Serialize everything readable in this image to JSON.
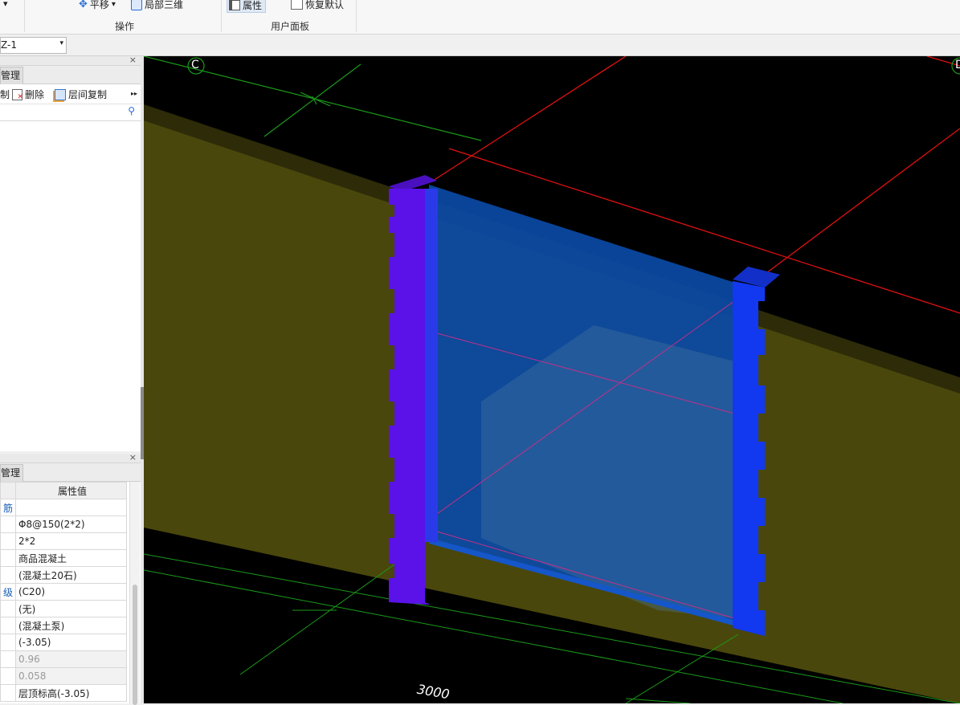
{
  "ribbon": {
    "pan_label": "平移",
    "pan_dropdown": "▾",
    "local3d_label": "局部三维",
    "props_label": "属性",
    "restore_label": "恢复默认",
    "group_operations": "操作",
    "group_user_panel": "用户面板",
    "left_arrow": "▾"
  },
  "toolbar2": {
    "component_value": "Z-1"
  },
  "top_panel": {
    "tab_label": "管理",
    "copy_partial": "制",
    "delete_label": "删除",
    "floor_copy_label": "层间复制",
    "more": "▸▸"
  },
  "bottom_panel": {
    "tab_label": "管理",
    "header_value": "属性值",
    "rows": [
      {
        "name": "筋",
        "value": ""
      },
      {
        "name": "",
        "value": "Φ8@150(2*2)"
      },
      {
        "name": "",
        "value": "2*2"
      },
      {
        "name": "",
        "value": "商品混凝土"
      },
      {
        "name": "",
        "value": "(混凝土20石)"
      },
      {
        "name": "级",
        "value": "(C20)"
      },
      {
        "name": "",
        "value": "(无)"
      },
      {
        "name": "",
        "value": "(混凝土泵)"
      },
      {
        "name": "",
        "value": "(-3.05)"
      },
      {
        "name": "",
        "value": "0.96",
        "grey": true
      },
      {
        "name": "",
        "value": "0.058",
        "grey": true
      },
      {
        "name": "",
        "value": "层顶标高(-3.05)"
      }
    ]
  },
  "viewport": {
    "axis_c": "C",
    "axis_d": "D",
    "dimension": "3000",
    "colors": {
      "wall": "#4a470c",
      "column_left": "#5a12e8",
      "column_right": "#1238f0",
      "opening": "#0a4aa6",
      "grid_red": "#e01010",
      "grid_green": "#1a9a1a"
    }
  }
}
